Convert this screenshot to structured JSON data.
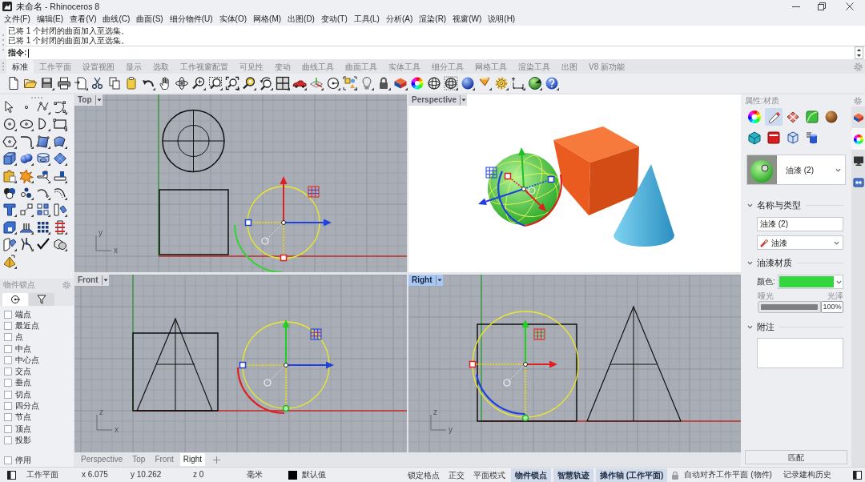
{
  "window": {
    "title": "未命名 - Rhinoceros 8"
  },
  "menu": [
    "文件(F)",
    "编辑(E)",
    "查看(V)",
    "曲线(C)",
    "曲面(S)",
    "细分物件(U)",
    "实体(O)",
    "网格(M)",
    "出图(D)",
    "变动(T)",
    "工具(L)",
    "分析(A)",
    "渲染(R)",
    "视窗(W)",
    "说明(H)"
  ],
  "command": {
    "history": [
      "已将 1 个封闭的曲面加入至选集。",
      "已将 1 个封闭的曲面加入至选集。"
    ],
    "prompt": "指令:"
  },
  "toolbar_tabs": [
    {
      "label": "标准",
      "selected": true
    },
    {
      "label": "工作平面",
      "selected": false
    },
    {
      "label": "设置视图",
      "selected": false
    },
    {
      "label": "显示",
      "selected": false
    },
    {
      "label": "选取",
      "selected": false
    },
    {
      "label": "工作视窗配置",
      "selected": false
    },
    {
      "label": "可见性",
      "selected": false
    },
    {
      "label": "变动",
      "selected": false
    },
    {
      "label": "曲线工具",
      "selected": false
    },
    {
      "label": "曲面工具",
      "selected": false
    },
    {
      "label": "实体工具",
      "selected": false
    },
    {
      "label": "细分工具",
      "selected": false
    },
    {
      "label": "网格工具",
      "selected": false
    },
    {
      "label": "渲染工具",
      "selected": false
    },
    {
      "label": "出图",
      "selected": false
    },
    {
      "label": "V8 新功能",
      "selected": false
    }
  ],
  "osnap_panel": {
    "title": "物件锁点",
    "tabs": [
      {
        "kind": "snap",
        "selected": true
      },
      {
        "kind": "filter",
        "selected": false
      }
    ],
    "items": [
      {
        "label": "端点",
        "checked": false
      },
      {
        "label": "最近点",
        "checked": false
      },
      {
        "label": "点",
        "checked": false
      },
      {
        "label": "中点",
        "checked": false
      },
      {
        "label": "中心点",
        "checked": false
      },
      {
        "label": "交点",
        "checked": false
      },
      {
        "label": "垂点",
        "checked": false
      },
      {
        "label": "切点",
        "checked": false
      },
      {
        "label": "四分点",
        "checked": false
      },
      {
        "label": "节点",
        "checked": false
      },
      {
        "label": "顶点",
        "checked": false
      },
      {
        "label": "投影",
        "checked": false
      }
    ],
    "disable": {
      "label": "停用",
      "checked": false
    }
  },
  "viewports": [
    {
      "name": "Top",
      "kind": "top",
      "selected": false,
      "axis_labels": [
        "y",
        "x"
      ]
    },
    {
      "name": "Perspective",
      "kind": "perspective",
      "selected": false
    },
    {
      "name": "Front",
      "kind": "front",
      "selected": false,
      "axis_labels": [
        "z",
        "x"
      ]
    },
    {
      "name": "Right",
      "kind": "right",
      "selected": true,
      "axis_labels": [
        "z",
        "y"
      ]
    }
  ],
  "viewport_tabs": [
    {
      "label": "Perspective",
      "selected": false
    },
    {
      "label": "Top",
      "selected": false
    },
    {
      "label": "Front",
      "selected": false
    },
    {
      "label": "Right",
      "selected": true
    }
  ],
  "properties_panel": {
    "title": "属性:材质",
    "material_types": [
      {
        "kind": "color-wheel",
        "selected": false
      },
      {
        "kind": "paint-tube",
        "selected": true
      },
      {
        "kind": "ribbon-block",
        "selected": false
      },
      {
        "kind": "leaf-tile",
        "selected": false
      },
      {
        "kind": "wood-sphere",
        "selected": false
      },
      {
        "kind": "gem",
        "selected": false
      },
      {
        "kind": "window-box",
        "selected": false
      },
      {
        "kind": "glass-cube",
        "selected": false
      },
      {
        "kind": "cylinder-stack",
        "selected": false
      }
    ],
    "material": {
      "name": "油漆 (2)"
    },
    "sections": [
      {
        "kind": "name_type",
        "title": "名称与类型",
        "expanded": true,
        "name": "油漆 (2)",
        "type": "油漆"
      },
      {
        "kind": "paint",
        "title": "油漆材质",
        "expanded": true,
        "color_label": "颜色:",
        "color": "#33d63f",
        "min_label": "哑光",
        "max_label": "光泽",
        "level": 1,
        "reading": "100%"
      },
      {
        "kind": "notes",
        "title": "附注",
        "expanded": true
      }
    ],
    "match_button": "匹配",
    "side_tabs": [
      {
        "kind": "layers",
        "selected": false
      },
      {
        "kind": "color-wheel",
        "selected": true
      },
      {
        "kind": "monitor",
        "selected": false
      },
      {
        "kind": "screen",
        "selected": false
      }
    ]
  },
  "status_bar": {
    "cplane": "工作平面",
    "coords": [
      "x 6.075",
      "y 10.262",
      "z 0"
    ],
    "units": "毫米",
    "layer": "默认值",
    "toggles": [
      {
        "label": "锁定格点",
        "on": false
      },
      {
        "label": "正交",
        "on": false
      },
      {
        "label": "平面模式",
        "on": false
      },
      {
        "label": "物件锁点",
        "on": true
      },
      {
        "label": "智慧轨迹",
        "on": true
      },
      {
        "label": "操作轴 (工作平面)",
        "on": true
      }
    ],
    "auto_align": "自动对齐工作平面 (物件)",
    "record_history": "记录建构历史"
  }
}
